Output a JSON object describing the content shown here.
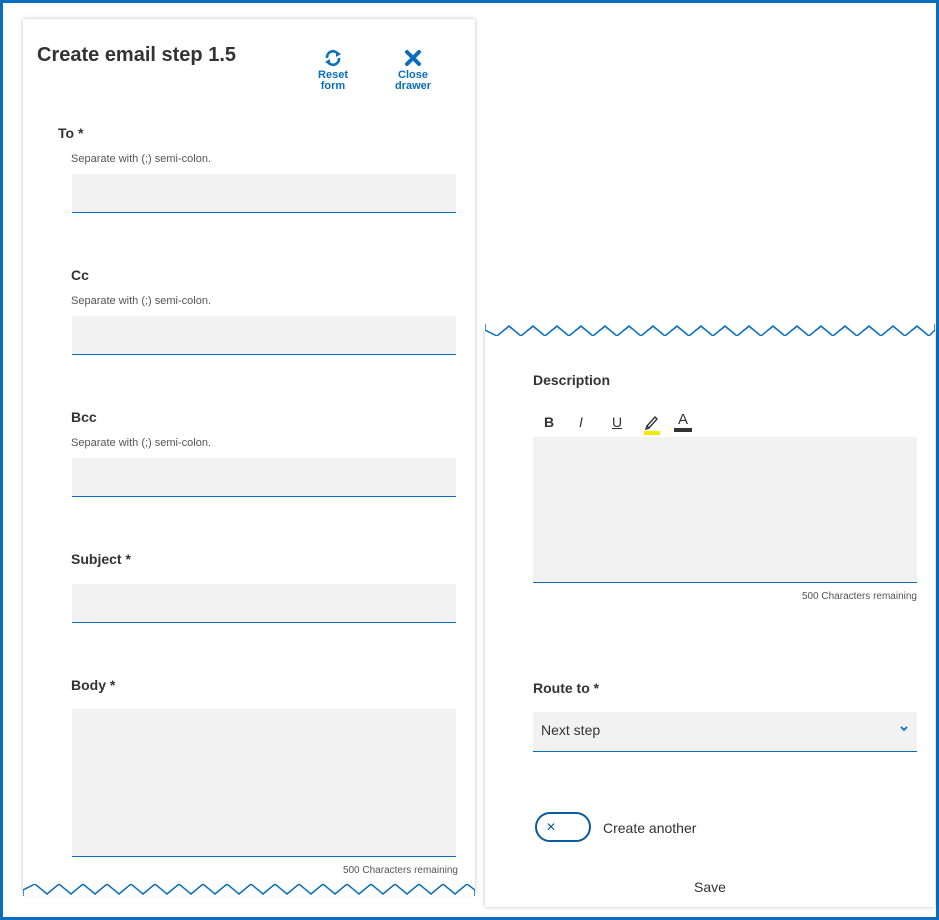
{
  "drawer": {
    "title": "Create email step 1.5",
    "reset_label_1": "Reset",
    "reset_label_2": "form",
    "close_label_1": "Close",
    "close_label_2": "drawer",
    "reset_icon": "refresh-icon",
    "close_icon": "close-icon"
  },
  "fields": {
    "to": {
      "label": "To *",
      "hint": "Separate with (;) semi-colon.",
      "value": ""
    },
    "cc": {
      "label": "Cc",
      "hint": "Separate with (;) semi-colon.",
      "value": ""
    },
    "bcc": {
      "label": "Bcc",
      "hint": "Separate with (;) semi-colon.",
      "value": ""
    },
    "subject": {
      "label": "Subject *",
      "value": ""
    },
    "body": {
      "label": "Body *",
      "counter": "500 Characters remaining"
    },
    "description": {
      "label": "Description",
      "counter": "500 Characters remaining"
    },
    "route_to": {
      "label": "Route to *",
      "selected": "Next step"
    }
  },
  "rte": {
    "bold": "B",
    "italic": "I",
    "underline": "U",
    "highlight_icon": "highlighter-icon",
    "font_color": "A"
  },
  "create_another": {
    "label": "Create another",
    "state": "off"
  },
  "save_label": "Save",
  "colors": {
    "accent": "#0a6ebd",
    "input_bg": "#f2f2f2",
    "highlight": "#f5e800",
    "font_color_bar": "#333333"
  }
}
